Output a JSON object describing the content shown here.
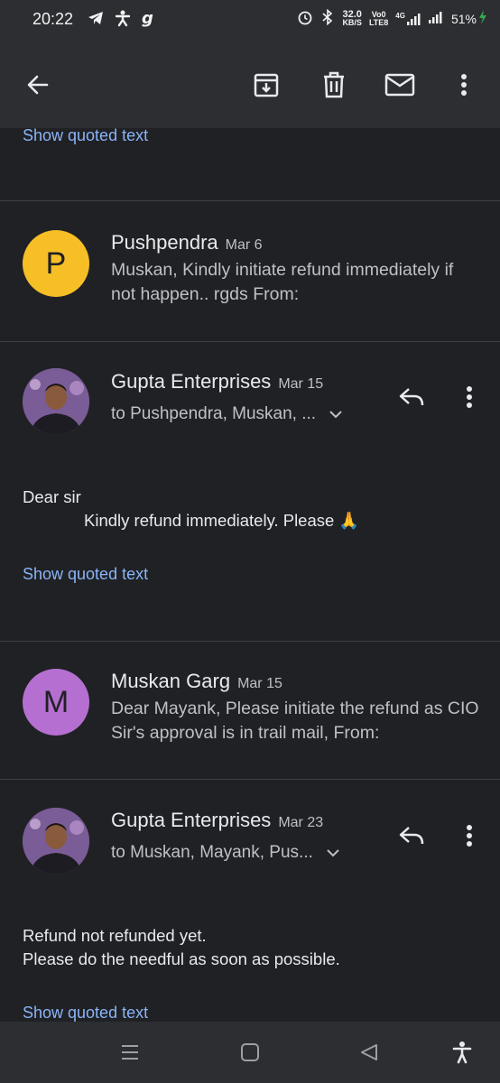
{
  "status_bar": {
    "time": "20:22",
    "left_icons": [
      "telegram-icon",
      "accessibility-person-icon",
      "g-app-icon"
    ],
    "speed_value": "32.0",
    "speed_unit": "KB/S",
    "volte_top": "Vo0",
    "volte_bottom": "LTE8",
    "network": "4G",
    "battery": "51%"
  },
  "app_bar": {
    "icons": [
      "back-arrow-icon",
      "archive-icon",
      "delete-icon",
      "mark-unread-icon",
      "more-vert-icon"
    ]
  },
  "top_link": "Show quoted text",
  "messages": [
    {
      "sender": "Pushpendra",
      "date": "Mar 6",
      "avatar_letter": "P",
      "avatar_color": "#f6bf26",
      "snippet": "Muskan, Kindly initiate refund immediately if not happen.. rgds From:"
    },
    {
      "sender": "Gupta Enterprises",
      "date": "Mar 15",
      "recipients": "to Pushpendra, Muskan, ...",
      "body_line1": "Dear sir",
      "body_line2": "Kindly refund immediately. Please 🙏",
      "link": "Show quoted text"
    },
    {
      "sender": "Muskan Garg",
      "date": "Mar 15",
      "avatar_letter": "M",
      "avatar_color": "#b56fd1",
      "snippet": "Dear Mayank, Please initiate the refund as CIO Sir's approval is in trail mail, From:"
    },
    {
      "sender": "Gupta Enterprises",
      "date": "Mar 23",
      "recipients": "to Muskan, Mayank, Pus...",
      "body_line1": "Refund not refunded yet.",
      "body_line2": "Please do the needful as soon as possible.",
      "link": "Show quoted text"
    }
  ],
  "nav_bar": {
    "icons": [
      "recent-apps-icon",
      "home-icon",
      "back-icon",
      "accessibility-icon"
    ]
  }
}
